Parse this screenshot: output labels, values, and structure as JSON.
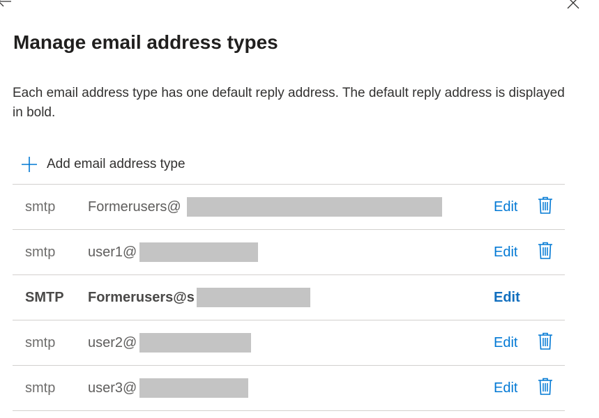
{
  "panel": {
    "title": "Manage email address types",
    "description": "Each email address type has one default reply address. The default reply address is displayed in bold.",
    "add_label": "Add email address type",
    "accent_color": "#0078d4"
  },
  "rows": [
    {
      "type": "smtp",
      "address": "Formerusers@",
      "edit_label": "Edit",
      "is_default": false,
      "has_delete": true
    },
    {
      "type": "smtp",
      "address": "user1@",
      "edit_label": "Edit",
      "is_default": false,
      "has_delete": true
    },
    {
      "type": "SMTP",
      "address": "Formerusers@s",
      "edit_label": "Edit",
      "is_default": true,
      "has_delete": false
    },
    {
      "type": "smtp",
      "address": "user2@",
      "edit_label": "Edit",
      "is_default": false,
      "has_delete": true
    },
    {
      "type": "smtp",
      "address": "user3@",
      "edit_label": "Edit",
      "is_default": false,
      "has_delete": true
    }
  ]
}
